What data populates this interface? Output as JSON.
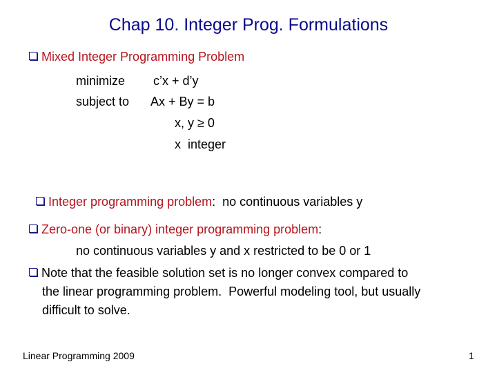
{
  "title": "Chap 10. Integer Prog. Formulations",
  "bullets": {
    "b1": {
      "heading": "Mixed Integer Programming Problem"
    },
    "formulation": {
      "minimize_label": "minimize",
      "objective": "c’x + d’y",
      "subject_to_label": "subject to",
      "constraint1": "Ax + By = b",
      "constraint2": "x, y ≥ 0",
      "constraint3": "x  integer"
    },
    "b2": {
      "heading": "Integer programming problem",
      "rest": ":  no continuous variables y"
    },
    "b3": {
      "heading": "Zero-one (or binary) integer programming problem",
      "rest": ":",
      "detail": "no continuous variables y and x restricted to be 0 or 1"
    },
    "b4": {
      "line1": "Note that the feasible solution set is no longer convex compared to",
      "line2": "the linear programming problem.  Powerful modeling tool, but usually",
      "line3": "difficult to solve."
    }
  },
  "footer": {
    "left": "Linear Programming 2009",
    "page": "1"
  },
  "colors": {
    "title": "#0a0a8c",
    "heading": "#b4141e",
    "bullet_box": "#1a1a8a"
  }
}
